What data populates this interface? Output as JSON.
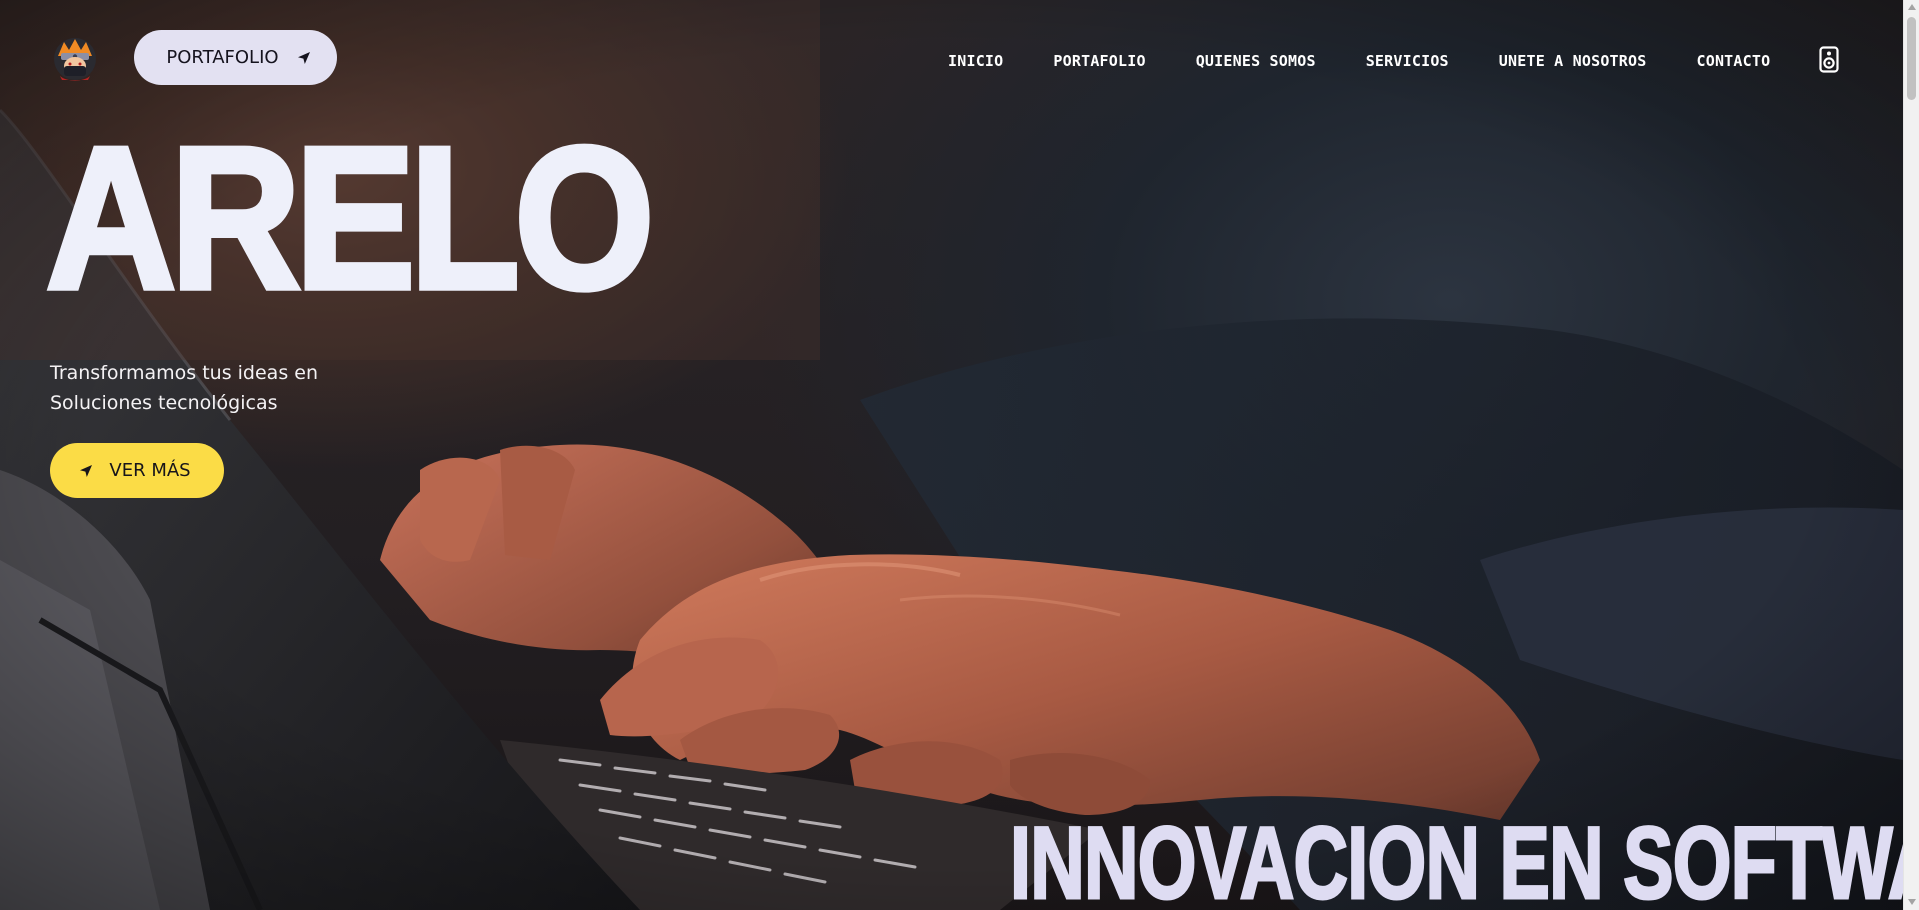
{
  "header": {
    "logo_icon": "ninja-avatar-logo-icon",
    "portfolio_pill": {
      "label": "PORTAFOLIO",
      "icon": "arrow-icon",
      "background": "#e3e1f2"
    },
    "nav": {
      "items": [
        {
          "label": "INICIO"
        },
        {
          "label": "PORTAFOLIO"
        },
        {
          "label": "QUIENES SOMOS"
        },
        {
          "label": "SERVICIOS"
        },
        {
          "label": "UNETE A NOSOTROS"
        },
        {
          "label": "CONTACTO"
        }
      ]
    },
    "speaker_icon": "speaker-icon"
  },
  "hero": {
    "title": "ARELO",
    "subtitle_lines": [
      "Transformamos tus ideas en",
      "Soluciones tecnológicas"
    ],
    "cta": {
      "label": "VER MÁS",
      "icon": "arrow-icon",
      "background": "#fbdc46"
    },
    "tagline": "INNOVACION EN SOFTWARE"
  },
  "colors": {
    "title_text": "#eef0fa",
    "tagline_text": "#dedcf2",
    "accent_yellow": "#fbdc46",
    "pill_lavender": "#e3e1f2"
  }
}
